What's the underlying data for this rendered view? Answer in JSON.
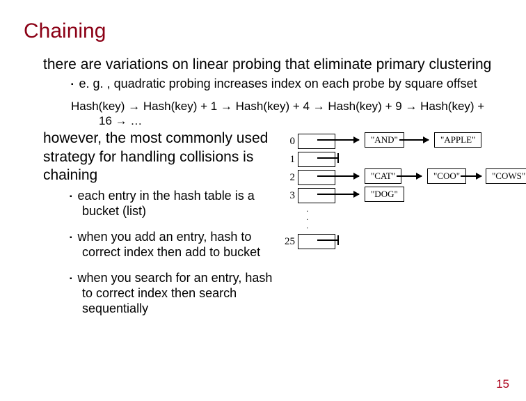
{
  "title": "Chaining",
  "intro": "there are variations on linear probing that eliminate primary clustering",
  "sub1": "e. g. , quadratic probing increases index on each probe by square offset",
  "codeline": "Hash(key) → Hash(key) + 1 → Hash(key) + 4 → Hash(key) + 9 → Hash(key) + 16 → …",
  "para2": "however, the most commonly used strategy for handling collisions is chaining",
  "bullet_a": "each entry in the hash table is a bucket (list)",
  "bullet_b": "when you add an entry, hash to correct index then add to bucket",
  "bullet_c": "when you search for an entry, hash to correct index then search sequentially",
  "diagram": {
    "rows": [
      "0",
      "1",
      "2",
      "3"
    ],
    "last": "25",
    "nodes": {
      "r0a": "\"AND\"",
      "r0b": "\"APPLE\"",
      "r2a": "\"CAT\"",
      "r2b": "\"COO\"",
      "r2c": "\"COWS\"",
      "r3a": "\"DOG\""
    }
  },
  "page": "15"
}
